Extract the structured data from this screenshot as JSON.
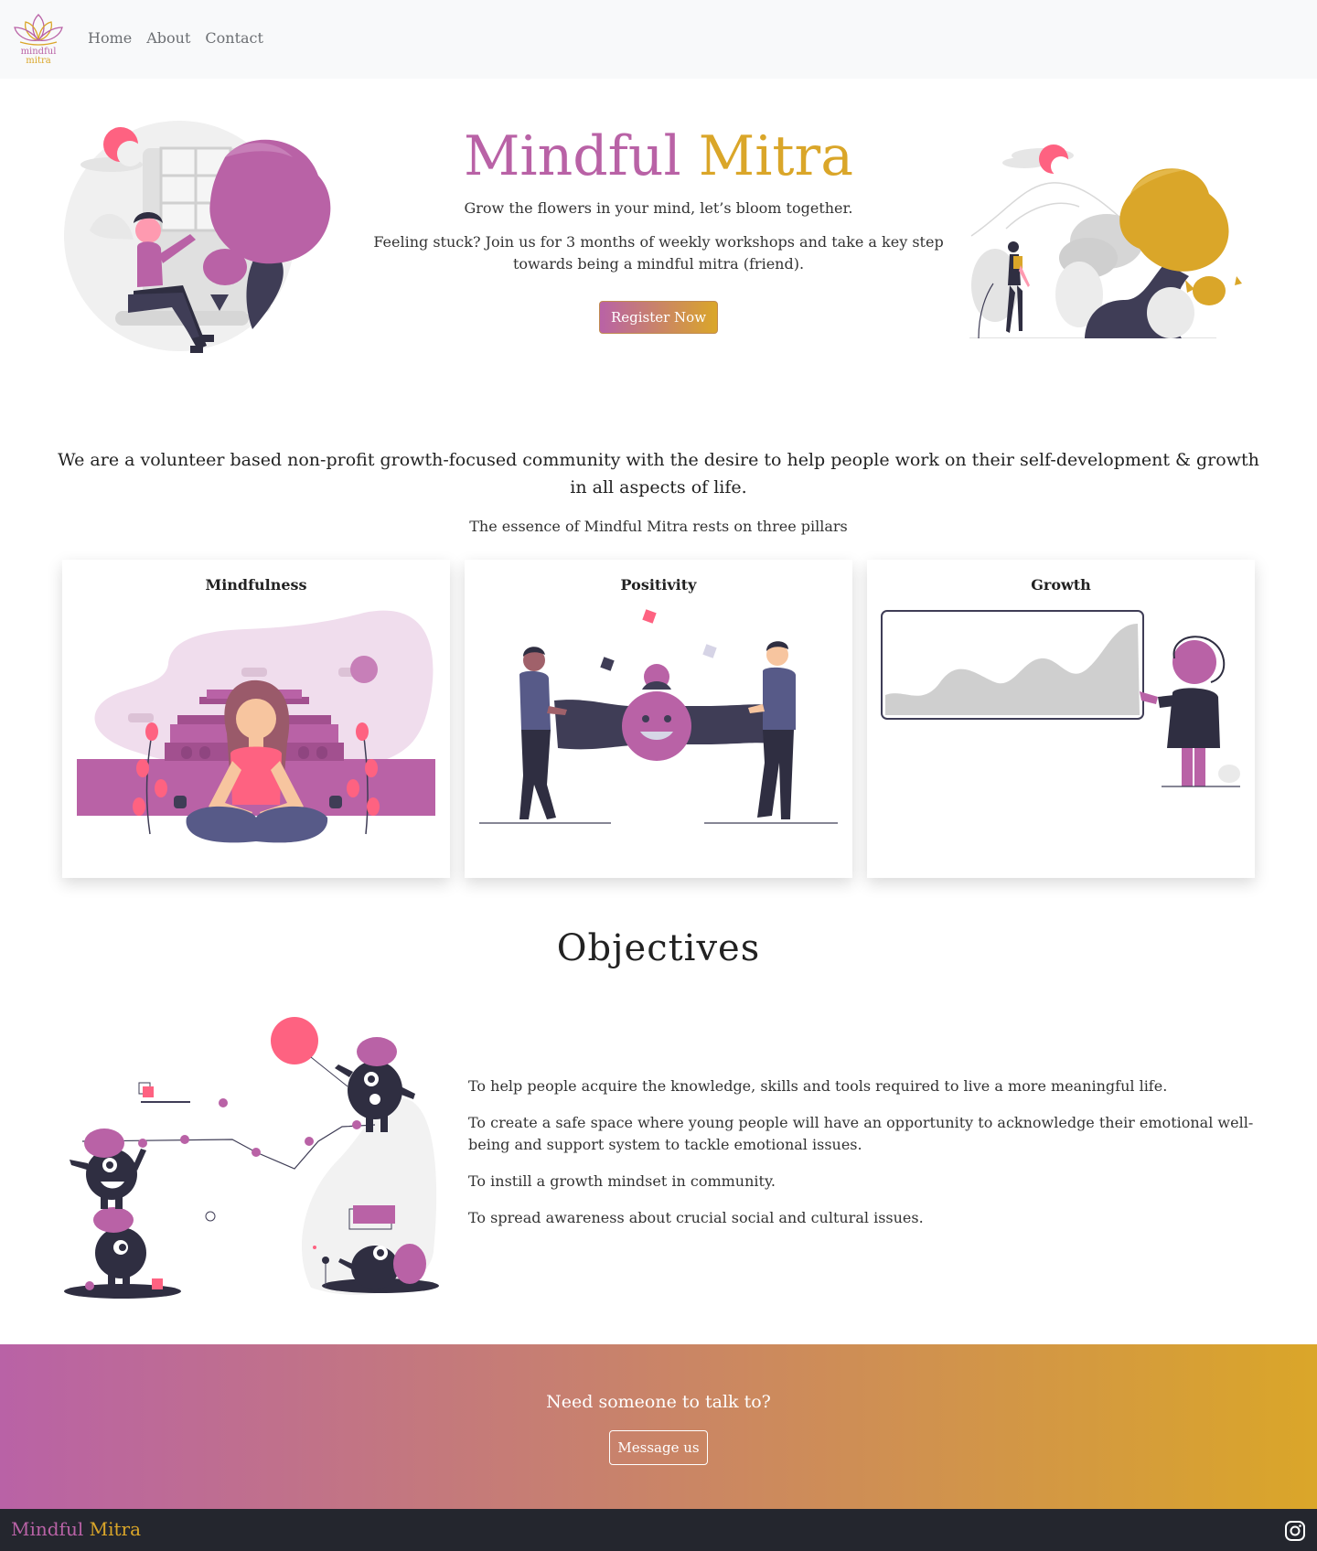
{
  "brand": {
    "logo_line1": "mindful",
    "logo_line2": "mitra",
    "name_part1": "Mindful",
    "name_part2": "Mitra",
    "colors": {
      "purple": "#b962a6",
      "gold": "#daa629",
      "dark": "#24262e",
      "pink": "#fe6281"
    }
  },
  "nav": {
    "items": [
      {
        "label": "Home"
      },
      {
        "label": "About"
      },
      {
        "label": "Contact"
      }
    ]
  },
  "hero": {
    "title_part1": "Mindful",
    "title_part2": "Mitra",
    "tagline": "Grow the flowers in your mind, let’s bloom together.",
    "description": "Feeling stuck? Join us for 3 months of weekly workshops and take a key step towards being a mindful mitra (friend).",
    "register_label": "Register Now"
  },
  "about": {
    "text": "We are a volunteer based non-profit growth-focused community with the desire to help people work on their self-development & growth in all aspects of life.",
    "pillars_intro": "The essence of Mindful Mitra rests on three pillars"
  },
  "pillars": [
    {
      "title": "Mindfulness"
    },
    {
      "title": "Positivity"
    },
    {
      "title": "Growth"
    }
  ],
  "objectives": {
    "title": "Objectives",
    "items": [
      "To help people acquire the knowledge, skills and tools required to live a more meaningful life.",
      "To create a safe space where young people will have an opportunity to acknowledge their emotional well-being and support system to tackle emotional issues.",
      "To instill a growth mindset in community.",
      "To spread awareness about crucial social and cultural issues."
    ]
  },
  "cta": {
    "text": "Need someone to talk to?",
    "button_label": "Message us"
  },
  "footer": {
    "brand_part1": "Mindful",
    "brand_part2": "Mitra",
    "social_icon": "instagram-icon"
  }
}
